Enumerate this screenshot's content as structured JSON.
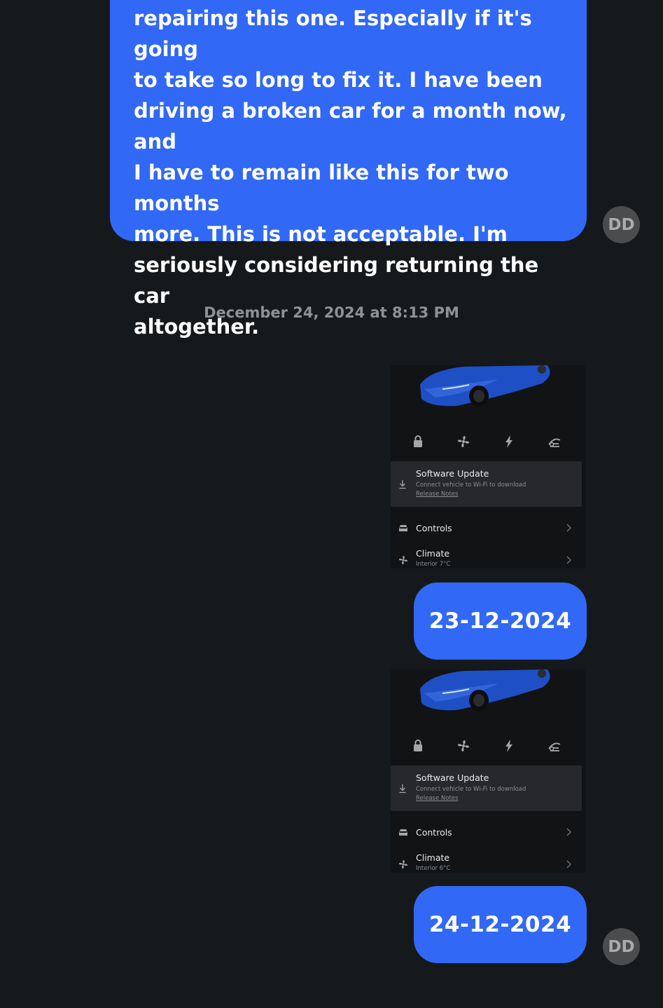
{
  "messages": {
    "long_text": "repairing this one. Especially if it's going\nto take so long to fix it. I have been\ndriving a broken car for a month now, and\nI have to remain like this for two months\nmore. This is not acceptable. I'm\nseriously considering returning the car\naltogether.",
    "timestamp": "December 24, 2024 at 8:13 PM",
    "date_1": "23-12-2024",
    "date_2": "24-12-2024",
    "avatar_initials": "DD"
  },
  "screenshot_1": {
    "software_update_title": "Software Update",
    "software_update_sub": "Connect vehicle to Wi-Fi to download",
    "release_notes": "Release Notes",
    "controls_label": "Controls",
    "climate_label": "Climate",
    "climate_meta": "Interior 7°C"
  },
  "screenshot_2": {
    "software_update_title": "Software Update",
    "software_update_sub": "Connect vehicle to Wi-Fi to download",
    "release_notes": "Release Notes",
    "controls_label": "Controls",
    "climate_label": "Climate",
    "climate_meta": "Interior 6°C"
  },
  "colors": {
    "background": "#16191b",
    "bubble": "#3168f5",
    "avatar": "#4a4c4e",
    "car_body": "#1f4fc4"
  },
  "icons": [
    "lock-icon",
    "fan-icon",
    "bolt-icon",
    "wiper-icon",
    "download-icon",
    "car-icon",
    "chevron-right-icon"
  ]
}
